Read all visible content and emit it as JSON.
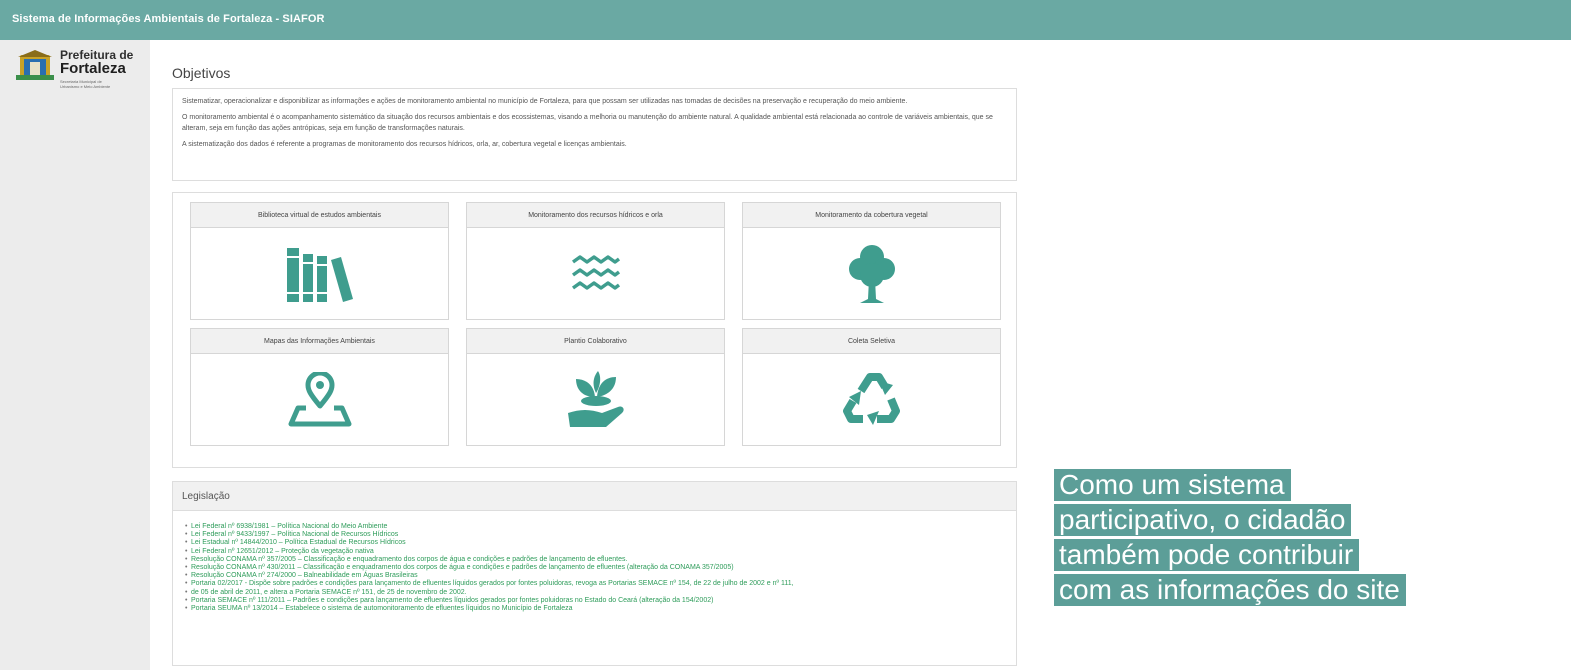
{
  "header": {
    "title": "Sistema de Informações Ambientais de Fortaleza - SIAFOR"
  },
  "logo": {
    "line1": "Prefeitura de",
    "line2": "Fortaleza",
    "line3": "Secretaria Municipal de",
    "line4": "Urbanismo e Meio Ambiente"
  },
  "objetivos": {
    "title": "Objetivos",
    "paragraphs": [
      "Sistematizar, operacionalizar e disponibilizar as informações e ações de monitoramento ambiental no município de Fortaleza, para que possam ser utilizadas nas tomadas de decisões na preservação e recuperação do meio ambiente.",
      "O monitoramento ambiental é o acompanhamento sistemático da situação dos recursos ambientais e dos ecossistemas, visando a melhoria ou manutenção do ambiente natural. A qualidade ambiental está relacionada ao controle de variáveis ambientais, que se alteram, seja em função das ações antrópicas, seja em função de transformações naturais.",
      "A sistematização dos dados é referente a programas de monitoramento dos recursos hídricos, orla, ar, cobertura vegetal e licenças ambientais."
    ]
  },
  "cards": [
    {
      "label": "Biblioteca virtual de estudos ambientais",
      "icon": "books-icon"
    },
    {
      "label": "Monitoramento dos recursos hídricos e orla",
      "icon": "waves-icon"
    },
    {
      "label": "Monitoramento da cobertura vegetal",
      "icon": "tree-icon"
    },
    {
      "label": "Mapas das Informações Ambientais",
      "icon": "map-pin-icon"
    },
    {
      "label": "Plantio Colaborativo",
      "icon": "plant-hand-icon"
    },
    {
      "label": "Coleta Seletiva",
      "icon": "recycle-icon"
    }
  ],
  "legislacao": {
    "title": "Legislação",
    "items": [
      "Lei Federal nº 6938/1981 – Política Nacional do Meio Ambiente",
      "Lei Federal nº 9433/1997 – Política Nacional de Recursos Hídricos",
      "Lei Estadual nº 14844/2010 – Política Estadual de Recursos Hídricos",
      "Lei Federal nº 12651/2012 – Proteção da vegetação nativa",
      "Resolução CONAMA nº 357/2005 – Classificação e enquadramento dos corpos de água e condições e padrões de lançamento de efluentes.",
      "Resolução CONAMA nº 430/2011 – Classificação e enquadramento dos corpos de água e condições e padrões de lançamento de efluentes (alteração da CONAMA 357/2005)",
      "Resolução CONAMA nº 274/2000 – Balneabilidade em Águas Brasileiras",
      "Portaria 02/2017 - Dispõe sobre padrões e condições para lançamento de efluentes líquidos gerados por fontes poluidoras, revoga as Portarias SEMACE nº 154, de 22 de julho de 2002 e nº 111,",
      "de 05 de abril de 2011, e altera a Portaria SEMACE nº 151, de 25 de novembro de 2002.",
      "Portaria SEMACE nº 111/2011 – Padrões e condições para lançamento de efluentes líquidos gerados por fontes poluidoras no Estado do Ceará (alteração da 154/2002)",
      "Portaria SEUMA nº 13/2014 – Estabelece o sistema de automonitoramento de efluentes líquidos no Município de Fortaleza"
    ]
  },
  "caption": {
    "lines": [
      "Como um sistema",
      "participativo, o cidadão",
      "também pode contribuir",
      "com as informações do site"
    ]
  },
  "colors": {
    "header": "#6aa9a3",
    "icon": "#3f9d8e",
    "link": "#2e9c5a",
    "caption_bg": "#5c9e98"
  }
}
